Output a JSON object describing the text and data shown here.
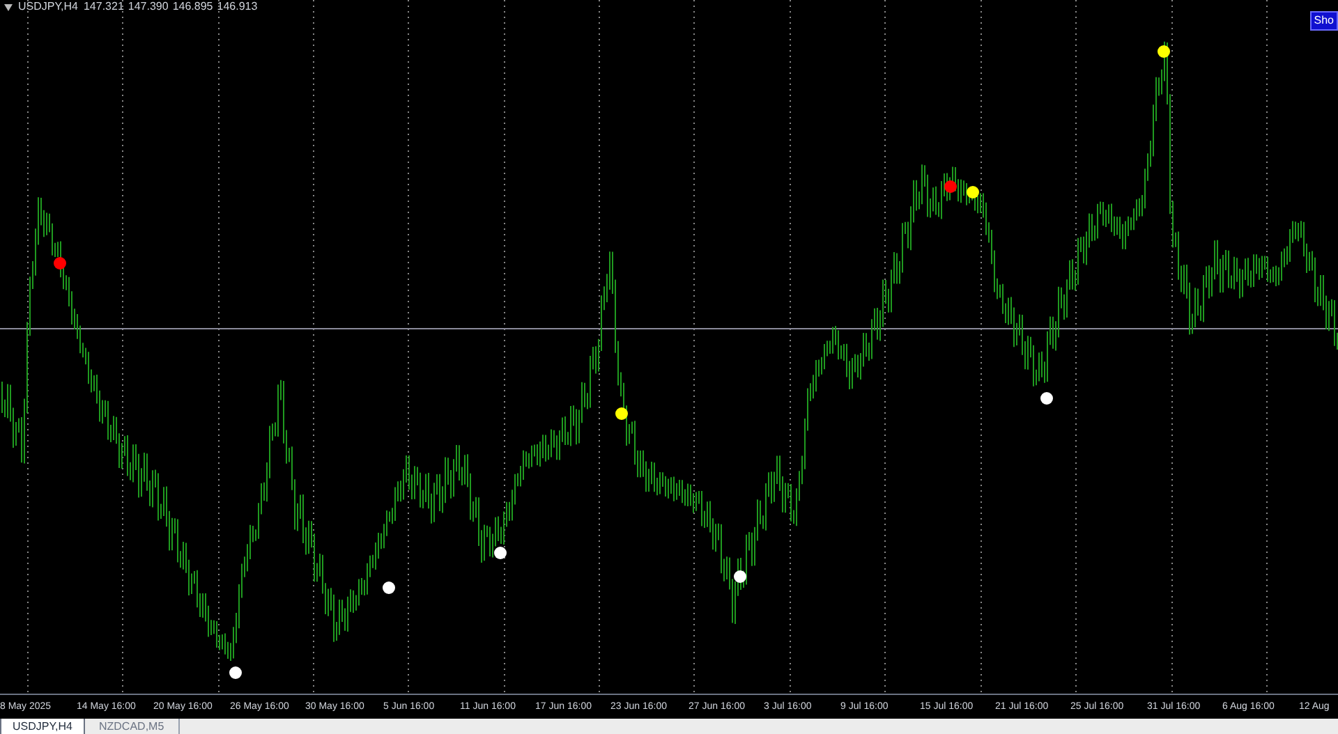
{
  "chart": {
    "symbol": "USDJPY,H4",
    "prices": [
      "147.321",
      "147.390",
      "146.895",
      "146.913"
    ],
    "show_button": "Sho",
    "markers": [
      {
        "color": "#ff0000"
      },
      {
        "color": "#ffffff"
      },
      {
        "color": "#ffffff"
      },
      {
        "color": "#ffffff"
      },
      {
        "color": "#ffff00"
      },
      {
        "color": "#ffffff"
      },
      {
        "color": "#ff0000"
      },
      {
        "color": "#ffff00"
      },
      {
        "color": "#ffffff"
      },
      {
        "color": "#ffff00"
      }
    ]
  },
  "time_axis": [
    "8 May 2025",
    "14 May 16:00",
    "20 May 16:00",
    "26 May 16:00",
    "30 May 16:00",
    "5 Jun 16:00",
    "11 Jun 16:00",
    "17 Jun 16:00",
    "23 Jun 16:00",
    "27 Jun 16:00",
    "3 Jul 16:00",
    "9 Jul 16:00",
    "15 Jul 16:00",
    "21 Jul 16:00",
    "25 Jul 16:00",
    "31 Jul 16:00",
    "6 Aug 16:00",
    "12 Aug"
  ],
  "tabs": [
    {
      "label": "USDJPY,H4",
      "selected": true
    },
    {
      "label": "NZDCAD,M5",
      "selected": false
    }
  ]
}
